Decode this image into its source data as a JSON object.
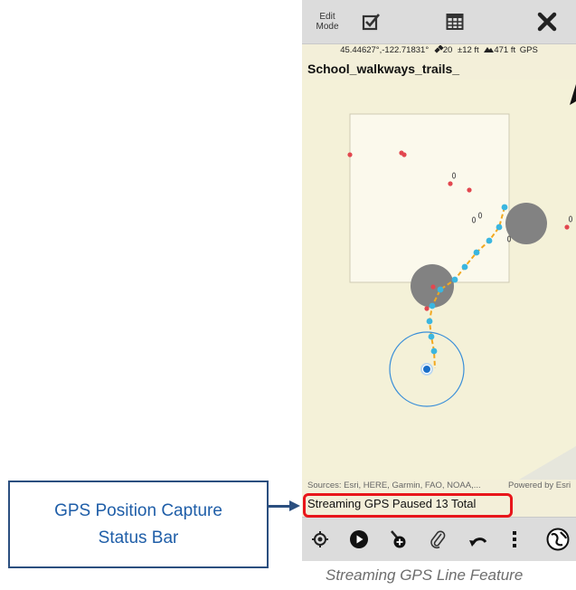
{
  "toolbar": {
    "edit_mode_line1": "Edit",
    "edit_mode_line2": "Mode",
    "icons": [
      "checkbox-icon",
      "table-icon",
      "close-icon"
    ]
  },
  "gps_info": {
    "coordinates": "45.44627°,-122.71831°",
    "satellites": "20",
    "accuracy": "±12 ft",
    "elevation": "471 ft",
    "source": "GPS"
  },
  "layer_name": "School_walkways_trails_",
  "map": {
    "attribution": "Sources: Esri, HERE, Garmin, FAO, NOAA,...",
    "powered_by": "Powered by Esri",
    "colors": {
      "track": "#f2a81e",
      "vertex": "#3bb6e0",
      "point": "#e2474f",
      "location": "#1a6fc9",
      "building": "#828282"
    }
  },
  "status_bar": {
    "prefix": "Streaming GPS Paused",
    "count": "13",
    "suffix": "Total"
  },
  "bottom_toolbar": {
    "icons": [
      "target-icon",
      "play-icon",
      "add-vertex-icon",
      "paperclip-icon",
      "undo-icon",
      "more-vertical-icon",
      "globe-icon"
    ]
  },
  "callout": {
    "line1": "GPS Position Capture",
    "line2": "Status Bar"
  },
  "caption": "Streaming GPS Line Feature"
}
